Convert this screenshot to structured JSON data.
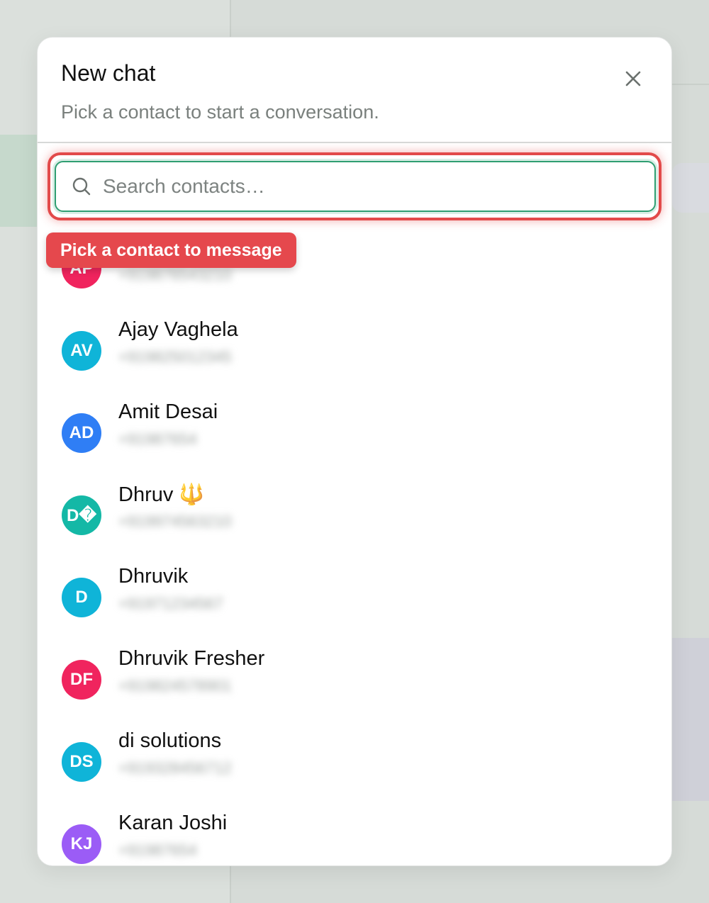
{
  "modal": {
    "title": "New chat",
    "subtitle": "Pick a contact to start a conversation."
  },
  "search": {
    "placeholder": "Search contacts…",
    "icon": "search-icon"
  },
  "tooltip": {
    "text": "Pick a contact to message"
  },
  "colors": {
    "accent_green": "#2f9e72",
    "error_red": "#e5484d"
  },
  "contacts": [
    {
      "initials": "AP",
      "name": "",
      "color": "#f0245e"
    },
    {
      "initials": "AV",
      "name": "Ajay Vaghela",
      "color": "#0fb4d8"
    },
    {
      "initials": "AD",
      "name": "Amit Desai",
      "color": "#2f7ef5"
    },
    {
      "initials": "D�",
      "name": "Dhruv 🔱",
      "color": "#14b8a6"
    },
    {
      "initials": "D",
      "name": "Dhruvik",
      "color": "#0fb4d8"
    },
    {
      "initials": "DF",
      "name": "Dhruvik Fresher",
      "color": "#f0245e"
    },
    {
      "initials": "DS",
      "name": "di solutions",
      "color": "#0fb4d8"
    },
    {
      "initials": "KJ",
      "name": "Karan Joshi",
      "color": "#9b5cf6"
    }
  ]
}
